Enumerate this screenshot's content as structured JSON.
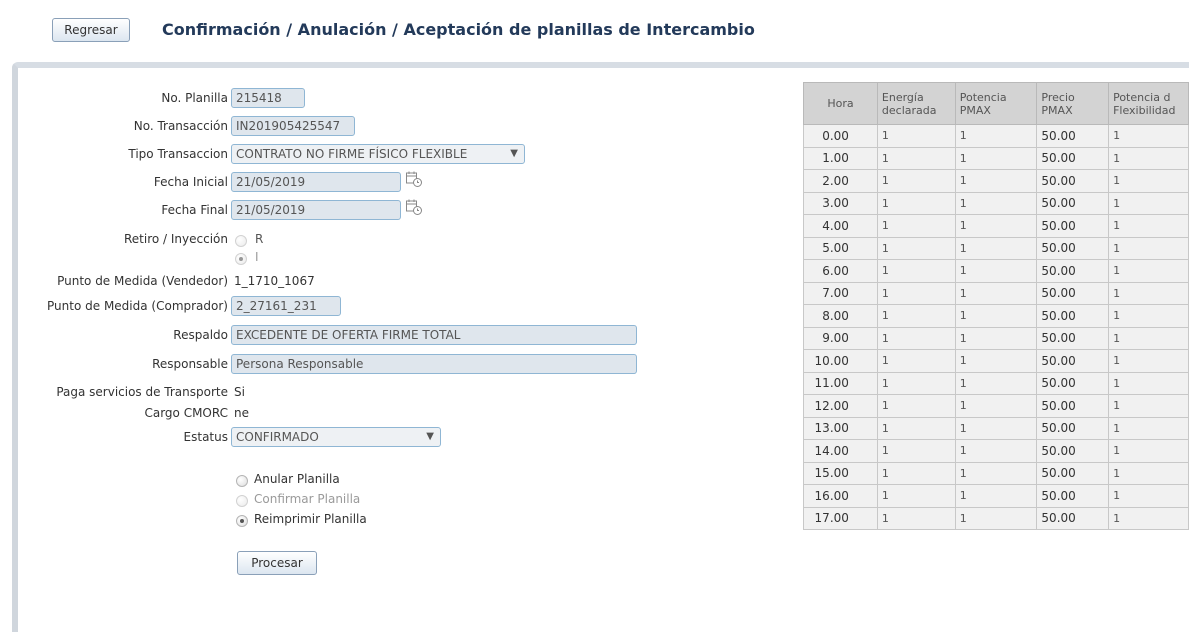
{
  "header": {
    "back_button": "Regresar",
    "title": "Confirmación / Anulación / Aceptación de planillas de Intercambio"
  },
  "form": {
    "no_planilla": {
      "label": "No. Planilla",
      "value": "215418"
    },
    "no_transaccion": {
      "label": "No. Transacción",
      "value": "IN201905425547"
    },
    "tipo_transaccion": {
      "label": "Tipo Transaccion",
      "value": "CONTRATO NO FIRME FÍSICO FLEXIBLE"
    },
    "fecha_inicial": {
      "label": "Fecha Inicial",
      "value": "21/05/2019"
    },
    "fecha_final": {
      "label": "Fecha Final",
      "value": "21/05/2019"
    },
    "retiro_inyeccion": {
      "label": "Retiro / Inyección",
      "option_r": "R",
      "option_i": "I"
    },
    "punto_vendedor": {
      "label": "Punto de Medida (Vendedor)",
      "value": "1_1710_1067"
    },
    "punto_comprador": {
      "label": "Punto de Medida (Comprador)",
      "value": "2_27161_231"
    },
    "respaldo": {
      "label": "Respaldo",
      "value": "EXCEDENTE DE OFERTA FIRME TOTAL"
    },
    "responsable": {
      "label": "Responsable",
      "value": "Persona Responsable"
    },
    "paga_servicios": {
      "label": "Paga servicios de Transporte",
      "value": "Si"
    },
    "cargo_cmorc": {
      "label": "Cargo CMORC",
      "value": "ne"
    },
    "estatus": {
      "label": "Estatus",
      "value": "CONFIRMADO"
    }
  },
  "actions": {
    "anular": "Anular Planilla",
    "confirmar": "Confirmar Planilla",
    "reimprimir": "Reimprimir Planilla",
    "procesar": "Procesar"
  },
  "table": {
    "headers": [
      "Hora",
      "Energía declarada",
      "Potencia PMAX",
      "Precio PMAX",
      "Potencia de Flexibilidad"
    ],
    "header_lines": [
      [
        "Hora"
      ],
      [
        "Energía",
        "declarada"
      ],
      [
        "Potencia",
        "PMAX"
      ],
      [
        "Precio",
        "PMAX"
      ],
      [
        "Potencia d",
        "Flexibilidad"
      ]
    ],
    "rows": [
      [
        "0.00",
        "1",
        "1",
        "50.00",
        "1"
      ],
      [
        "1.00",
        "1",
        "1",
        "50.00",
        "1"
      ],
      [
        "2.00",
        "1",
        "1",
        "50.00",
        "1"
      ],
      [
        "3.00",
        "1",
        "1",
        "50.00",
        "1"
      ],
      [
        "4.00",
        "1",
        "1",
        "50.00",
        "1"
      ],
      [
        "5.00",
        "1",
        "1",
        "50.00",
        "1"
      ],
      [
        "6.00",
        "1",
        "1",
        "50.00",
        "1"
      ],
      [
        "7.00",
        "1",
        "1",
        "50.00",
        "1"
      ],
      [
        "8.00",
        "1",
        "1",
        "50.00",
        "1"
      ],
      [
        "9.00",
        "1",
        "1",
        "50.00",
        "1"
      ],
      [
        "10.00",
        "1",
        "1",
        "50.00",
        "1"
      ],
      [
        "11.00",
        "1",
        "1",
        "50.00",
        "1"
      ],
      [
        "12.00",
        "1",
        "1",
        "50.00",
        "1"
      ],
      [
        "13.00",
        "1",
        "1",
        "50.00",
        "1"
      ],
      [
        "14.00",
        "1",
        "1",
        "50.00",
        "1"
      ],
      [
        "15.00",
        "1",
        "1",
        "50.00",
        "1"
      ],
      [
        "16.00",
        "1",
        "1",
        "50.00",
        "1"
      ],
      [
        "17.00",
        "1",
        "1",
        "50.00",
        "1"
      ]
    ]
  },
  "colors": {
    "title": "#233a5a",
    "input_border": "#8fb6d4",
    "input_bg": "#dfe6ed",
    "table_header_bg": "#d3d3d3",
    "table_cell_bg": "#f1f1f1"
  }
}
